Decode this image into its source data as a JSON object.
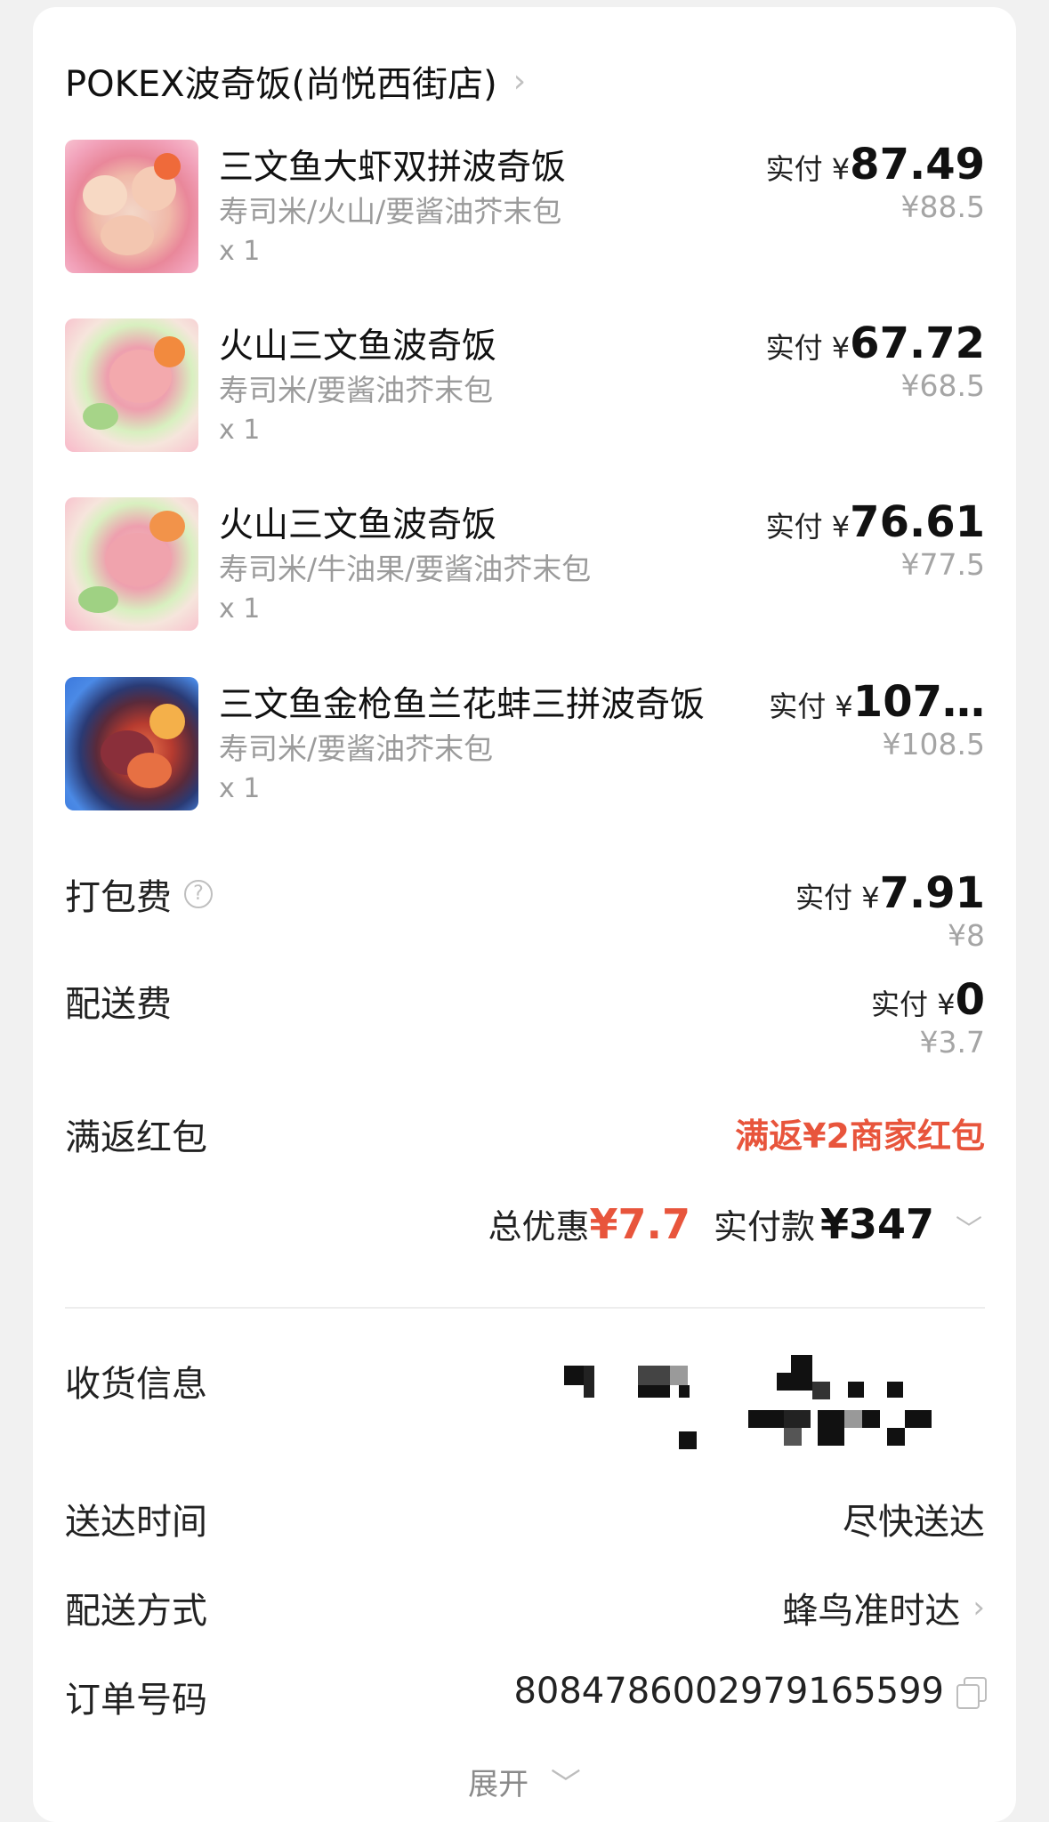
{
  "store": {
    "name": "POKEX波奇饭(尚悦西街店)",
    "chevron": "›"
  },
  "paid_prefix": "实付 ¥",
  "items": [
    {
      "name": "三文鱼大虾双拼波奇饭",
      "spec": "寿司米/火山/要酱油芥末包",
      "qty": "x 1",
      "paid": "87.49",
      "orig": "¥88.5",
      "image": "salmon-shrimp-bowl"
    },
    {
      "name": "火山三文鱼波奇饭",
      "spec": "寿司米/要酱油芥末包",
      "qty": "x 1",
      "paid": "67.72",
      "orig": "¥68.5",
      "image": "volcano-salmon-bowl"
    },
    {
      "name": "火山三文鱼波奇饭",
      "spec": "寿司米/牛油果/要酱油芥末包",
      "qty": "x 1",
      "paid": "76.61",
      "orig": "¥77.5",
      "image": "volcano-salmon-bowl"
    },
    {
      "name": "三文鱼金枪鱼兰花蚌三拼波奇饭",
      "spec": "寿司米/要酱油芥末包",
      "qty": "x 1",
      "paid": "107…",
      "orig": "¥108.5",
      "image": "triple-poke-bowl"
    }
  ],
  "fees": {
    "packing": {
      "label": "打包费",
      "help_icon": "question-circle-icon",
      "paid": "7.91",
      "orig": "¥8"
    },
    "delivery": {
      "label": "配送费",
      "paid": "0",
      "orig": "¥3.7"
    }
  },
  "redpacket": {
    "label": "满返红包",
    "value": "满返¥2商家红包"
  },
  "summary": {
    "discount_label": "总优惠",
    "discount_value": "¥7.7",
    "total_label": "实付款",
    "total_value": "¥347",
    "chevron": "﹀"
  },
  "info": {
    "receiver": {
      "label": "收货信息"
    },
    "delivery_time": {
      "label": "送达时间",
      "value": "尽快送达"
    },
    "delivery_method": {
      "label": "配送方式",
      "value": "蜂鸟准时达",
      "chevron": "›"
    },
    "order_no": {
      "label": "订单号码",
      "value": "8084786002979165599"
    }
  },
  "expand": {
    "label": "展开",
    "chevron": "﹀"
  },
  "colors": {
    "accent_red": "#e8553c",
    "muted": "#9b9b9b"
  }
}
